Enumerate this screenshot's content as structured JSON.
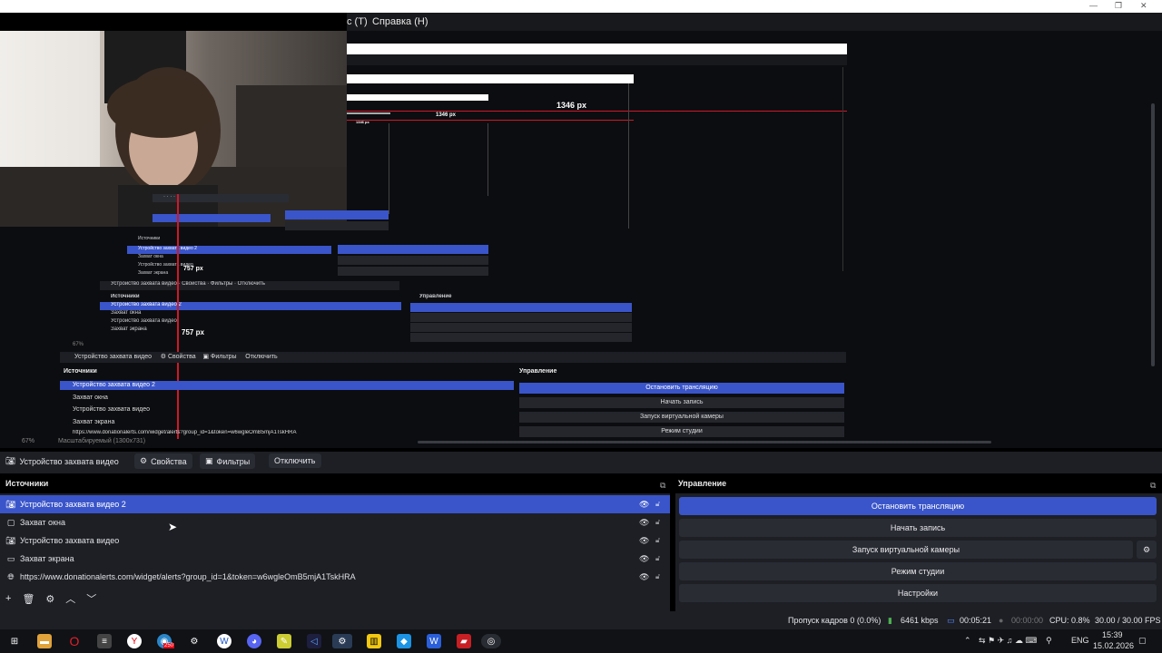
{
  "menu": {
    "tools": "с (Т)",
    "help": "Справка (Н)"
  },
  "preview": {
    "big_px": "1346 px",
    "mid_px": "1346 px",
    "small_px": "1346 px",
    "v_px_1": "757 px",
    "v_px_2": "757 px",
    "zoom": "67%",
    "scale_label": "Масштабируемый (1300x731)"
  },
  "dock": {
    "source_name": "Устройство захвата видео",
    "properties": "Свойства",
    "filters": "Фильтры",
    "disable": "Отключить"
  },
  "panels": {
    "sources_title": "Источники",
    "controls_title": "Управление"
  },
  "sources": [
    {
      "name": "Устройство захвата видео 2",
      "icon": "camera-icon",
      "selected": true
    },
    {
      "name": "Захват окна",
      "icon": "window-icon",
      "selected": false
    },
    {
      "name": "Устройство захвата видео",
      "icon": "camera-icon",
      "selected": false
    },
    {
      "name": "Захват экрана",
      "icon": "monitor-icon",
      "selected": false
    },
    {
      "name": "https://www.donationalerts.com/widget/alerts?group_id=1&token=w6wgleOmB5mjA1TskHRA",
      "icon": "globe-icon",
      "selected": false
    }
  ],
  "controls": {
    "stop_stream": "Остановить трансляцию",
    "start_record": "Начать запись",
    "virtual_cam": "Запуск виртуальной камеры",
    "studio_mode": "Режим студии",
    "settings": "Настройки"
  },
  "status": {
    "dropped": "Пропуск кадров 0 (0.0%)",
    "bitrate": "6461 kbps",
    "stream_time": "00:05:21",
    "rec_time": "00:00:00",
    "cpu": "CPU: 0.8%",
    "fps": "30.00 / 30.00 FPS"
  },
  "taskbar": {
    "lang": "ENG",
    "time": "15:39",
    "date": "15.02.2026",
    "badge": "250"
  },
  "colors": {
    "accent": "#3a55c9",
    "panel": "#1d1f25",
    "red_guide": "#d0182a"
  }
}
